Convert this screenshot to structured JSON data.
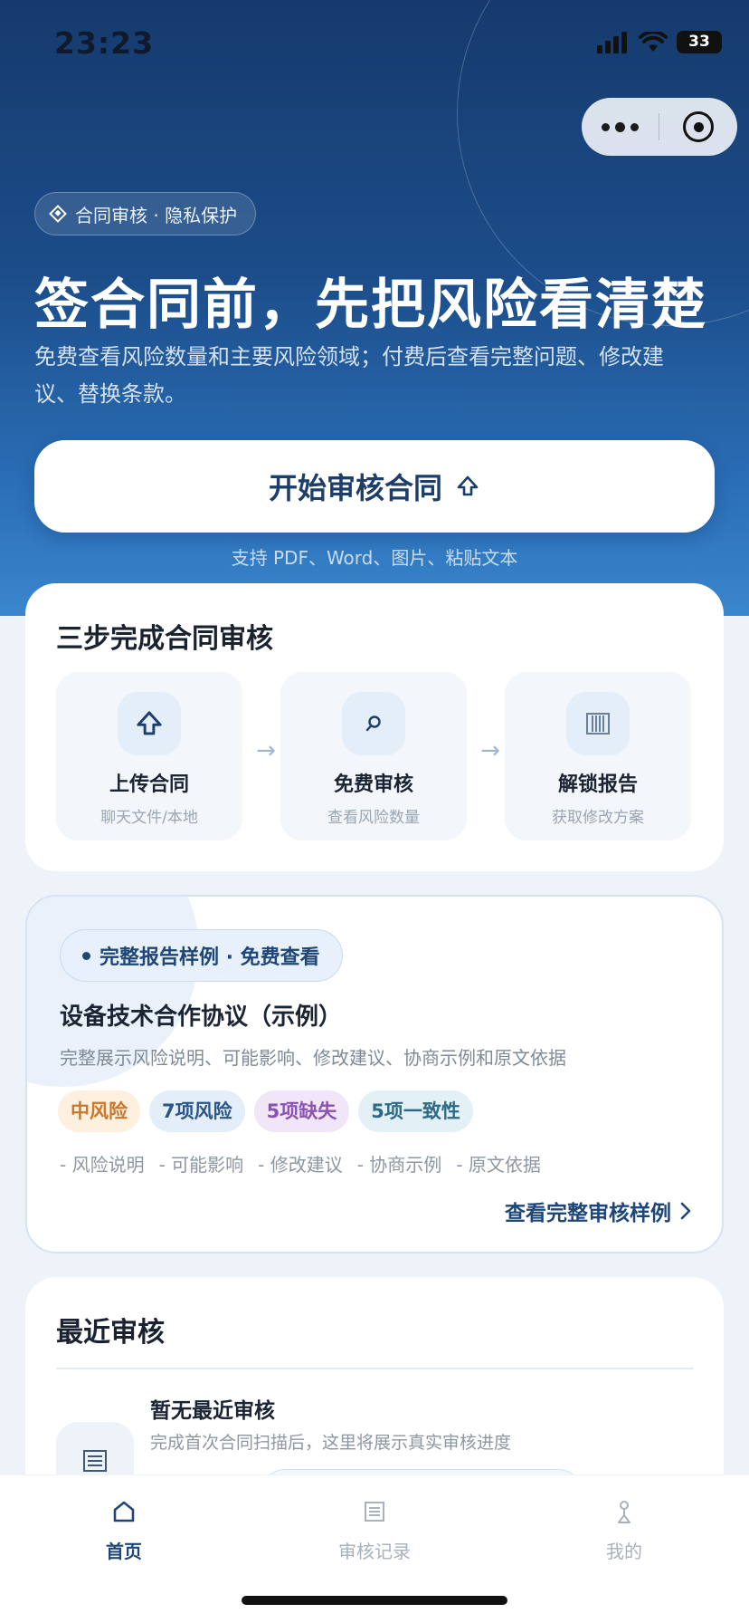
{
  "status_bar": {
    "time": "23:23",
    "battery": "33"
  },
  "hero": {
    "tag": "合同审核 · 隐私保护",
    "title": "签合同前，先把风险看清楚",
    "subtitle": "免费查看风险数量和主要风险领域；付费后查看完整问题、修改建议、替换条款。",
    "cta_label": "开始审核合同",
    "formats_hint": "支持 PDF、Word、图片、粘贴文本"
  },
  "steps": {
    "title": "三步完成合同审核",
    "items": [
      {
        "title": "上传合同",
        "subtitle": "聊天文件/本地",
        "icon": "upload-icon"
      },
      {
        "title": "免费审核",
        "subtitle": "查看风险数量",
        "icon": "search-icon"
      },
      {
        "title": "解锁报告",
        "subtitle": "获取修改方案",
        "icon": "report-icon"
      }
    ]
  },
  "sample": {
    "pill": "完整报告样例 · 免费查看",
    "title": "设备技术合作协议（示例）",
    "description": "完整展示风险说明、可能影响、修改建议、协商示例和原文依据",
    "chips": [
      "中风险",
      "7项风险",
      "5项缺失",
      "5项一致性"
    ],
    "items": [
      "- 风险说明",
      "- 可能影响",
      "- 修改建议",
      "- 协商示例",
      "- 原文依据"
    ],
    "link": "查看完整审核样例"
  },
  "recent": {
    "title": "最近审核",
    "empty_title": "暂无最近审核",
    "empty_desc": "完成首次合同扫描后，这里将展示真实审核进度"
  },
  "tabbar": {
    "items": [
      {
        "label": "首页",
        "icon": "home-icon",
        "active": true
      },
      {
        "label": "审核记录",
        "icon": "list-icon",
        "active": false
      },
      {
        "label": "我的",
        "icon": "user-icon",
        "active": false
      }
    ]
  },
  "colors": {
    "brand": "#1e4677",
    "hero_top": "#163a6d",
    "hero_bottom": "#3a86cc"
  }
}
